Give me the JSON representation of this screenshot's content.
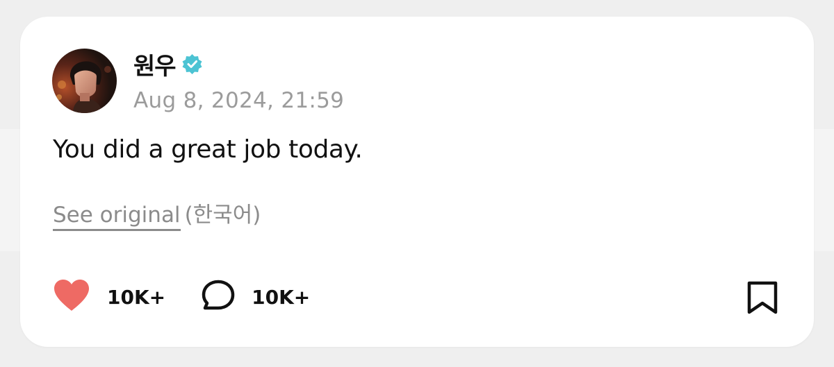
{
  "post": {
    "author": {
      "name": "원우",
      "verified": true,
      "avatar_icon": "profile-photo"
    },
    "timestamp": "Aug 8, 2024, 21:59",
    "text": "You did a great job today.",
    "translation": {
      "link_label": "See original",
      "language_note": "(한국어)"
    },
    "actions": {
      "likes": {
        "icon": "heart-icon",
        "count": "10K+"
      },
      "comments": {
        "icon": "comment-bubble-icon",
        "count": "10K+"
      },
      "bookmark": {
        "icon": "bookmark-icon"
      }
    }
  },
  "colors": {
    "page_background": "#efefef",
    "card_background": "#ffffff",
    "verified_badge": "#4cc3d3",
    "like_heart": "#ee6a64",
    "muted_text": "#9b9b9b",
    "primary_text": "#111111"
  }
}
